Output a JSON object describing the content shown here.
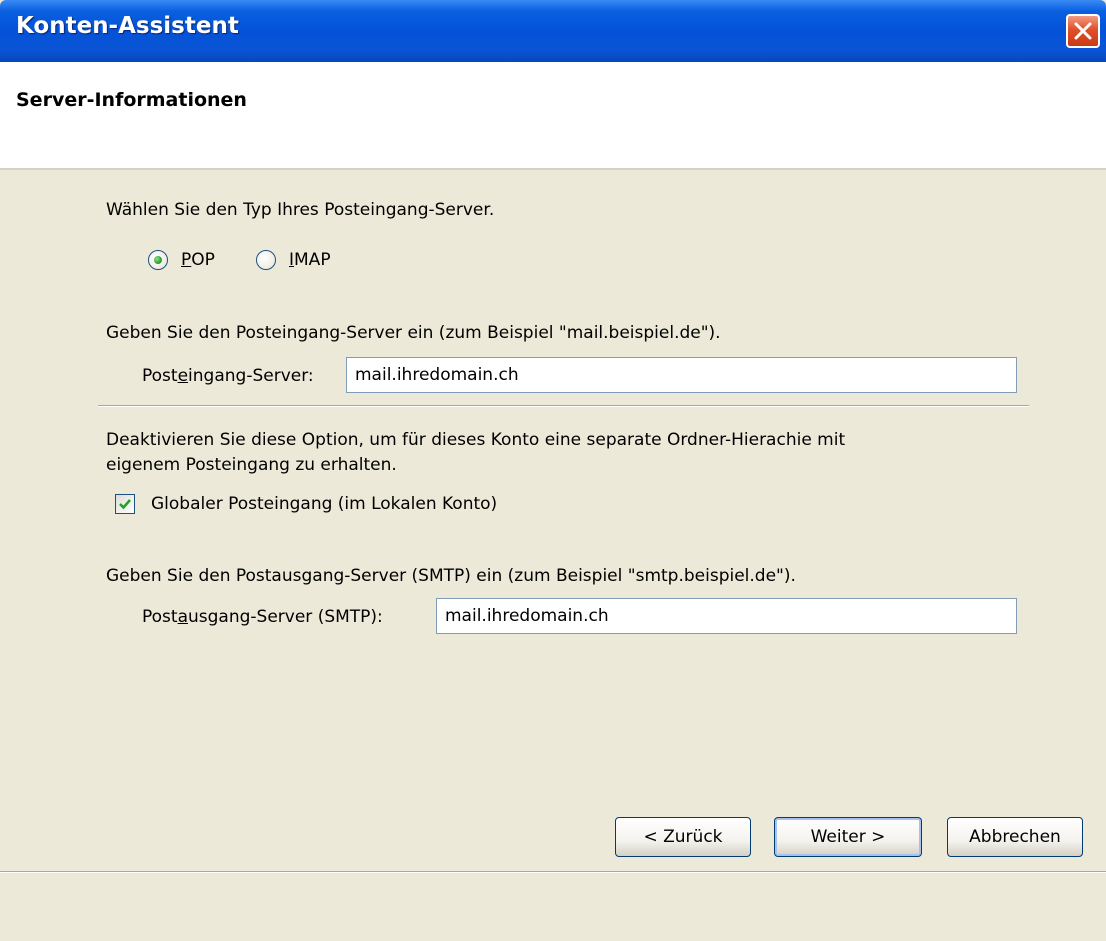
{
  "window": {
    "title": "Konten-Assistent",
    "header_title": "Server-Informationen"
  },
  "server_type": {
    "prompt": "Wählen Sie den Typ Ihres Posteingang-Server.",
    "options": [
      {
        "accel": "P",
        "rest": "OP",
        "selected": true
      },
      {
        "accel": "I",
        "rest": "MAP",
        "selected": false
      }
    ]
  },
  "incoming": {
    "prompt": "Geben Sie den Posteingang-Server ein (zum Beispiel \"mail.beispiel.de\").",
    "label_pre": "Post",
    "label_accel": "e",
    "label_post": "ingang-Server:",
    "value": "mail.ihredomain.ch"
  },
  "global_inbox": {
    "prompt_line1": "Deaktivieren Sie diese Option, um für dieses Konto eine separate Ordner-Hierachie mit",
    "prompt_line2": "eigenem Posteingang zu erhalten.",
    "checkbox_label": "Globaler Posteingang (im Lokalen Konto)",
    "checked": true
  },
  "outgoing": {
    "prompt": "Geben Sie den Postausgang-Server (SMTP) ein (zum Beispiel \"smtp.beispiel.de\").",
    "label_pre": "Post",
    "label_accel": "a",
    "label_post": "usgang-Server (SMTP):",
    "value": "mail.ihredomain.ch"
  },
  "buttons": {
    "back": "< Zurück",
    "next": "Weiter >",
    "cancel": "Abbrechen"
  }
}
